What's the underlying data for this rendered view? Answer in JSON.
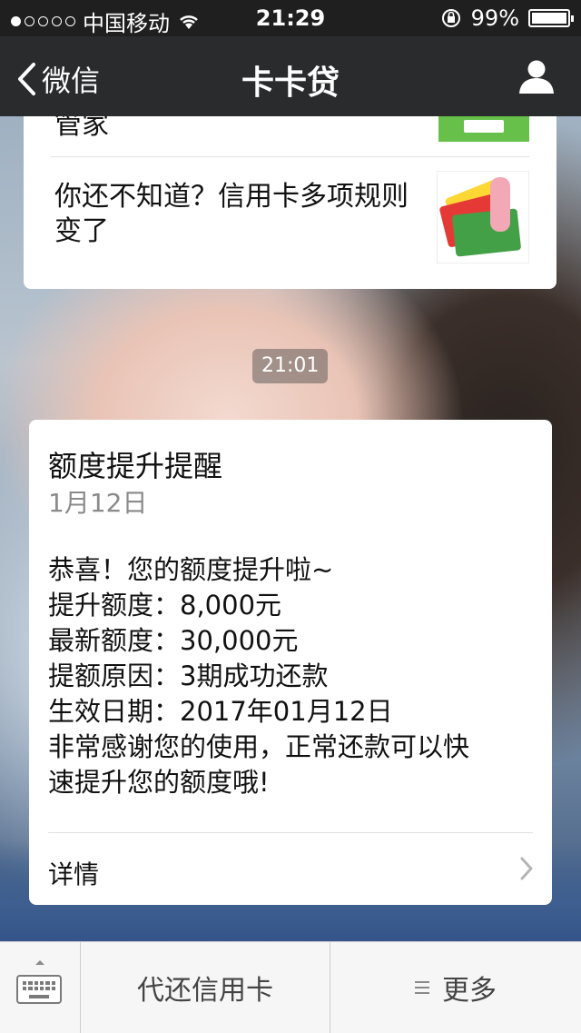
{
  "status_bar": {
    "carrier": "中国移动",
    "time": "21:29",
    "battery_percent": "99%",
    "signal_bars_filled": 1,
    "signal_bars_total": 5
  },
  "nav": {
    "back_label": "微信",
    "title": "卡卡贷"
  },
  "prev_article": {
    "partial_title": "管家",
    "title": "你还不知道？信用卡多项规则变了"
  },
  "chat": {
    "timestamp": "21:01"
  },
  "notice": {
    "title": "额度提升提醒",
    "date": "1月12日",
    "lines": [
      "恭喜！您的额度提升啦~",
      "提升额度：8,000元",
      "最新额度：30,000元",
      "提额原因：3期成功还款",
      "生效日期：2017年01月12日",
      "非常感谢您的使用，正常还款可以快",
      "速提升您的额度哦!"
    ],
    "details_label": "详情"
  },
  "bottom_menu": {
    "item1": "代还信用卡",
    "item2": "更多"
  },
  "icons": {
    "back": "chevron-left-icon",
    "profile": "person-icon",
    "keyboard": "keyboard-icon",
    "menu": "menu-lines-icon",
    "details": "chevron-right-icon"
  }
}
